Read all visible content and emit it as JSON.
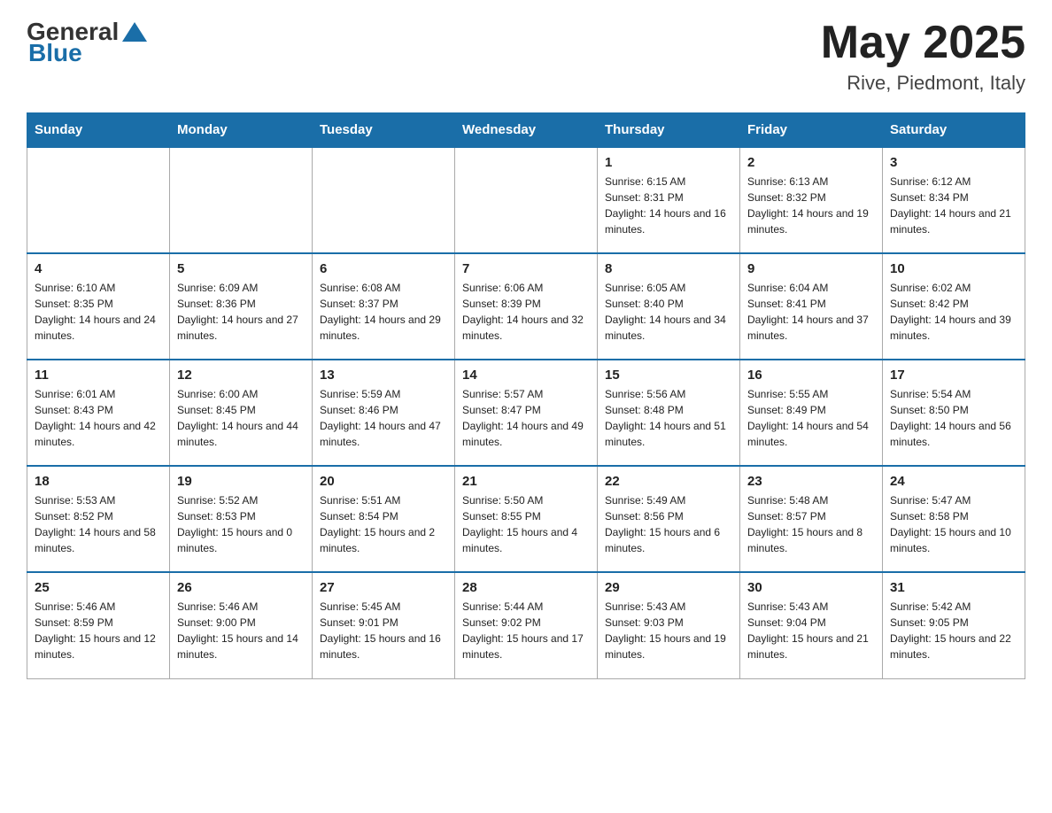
{
  "header": {
    "logo": {
      "general": "General",
      "blue": "Blue"
    },
    "month_year": "May 2025",
    "location": "Rive, Piedmont, Italy"
  },
  "days_of_week": [
    "Sunday",
    "Monday",
    "Tuesday",
    "Wednesday",
    "Thursday",
    "Friday",
    "Saturday"
  ],
  "weeks": [
    {
      "days": [
        {
          "num": "",
          "info": ""
        },
        {
          "num": "",
          "info": ""
        },
        {
          "num": "",
          "info": ""
        },
        {
          "num": "",
          "info": ""
        },
        {
          "num": "1",
          "info": "Sunrise: 6:15 AM\nSunset: 8:31 PM\nDaylight: 14 hours and 16 minutes."
        },
        {
          "num": "2",
          "info": "Sunrise: 6:13 AM\nSunset: 8:32 PM\nDaylight: 14 hours and 19 minutes."
        },
        {
          "num": "3",
          "info": "Sunrise: 6:12 AM\nSunset: 8:34 PM\nDaylight: 14 hours and 21 minutes."
        }
      ]
    },
    {
      "days": [
        {
          "num": "4",
          "info": "Sunrise: 6:10 AM\nSunset: 8:35 PM\nDaylight: 14 hours and 24 minutes."
        },
        {
          "num": "5",
          "info": "Sunrise: 6:09 AM\nSunset: 8:36 PM\nDaylight: 14 hours and 27 minutes."
        },
        {
          "num": "6",
          "info": "Sunrise: 6:08 AM\nSunset: 8:37 PM\nDaylight: 14 hours and 29 minutes."
        },
        {
          "num": "7",
          "info": "Sunrise: 6:06 AM\nSunset: 8:39 PM\nDaylight: 14 hours and 32 minutes."
        },
        {
          "num": "8",
          "info": "Sunrise: 6:05 AM\nSunset: 8:40 PM\nDaylight: 14 hours and 34 minutes."
        },
        {
          "num": "9",
          "info": "Sunrise: 6:04 AM\nSunset: 8:41 PM\nDaylight: 14 hours and 37 minutes."
        },
        {
          "num": "10",
          "info": "Sunrise: 6:02 AM\nSunset: 8:42 PM\nDaylight: 14 hours and 39 minutes."
        }
      ]
    },
    {
      "days": [
        {
          "num": "11",
          "info": "Sunrise: 6:01 AM\nSunset: 8:43 PM\nDaylight: 14 hours and 42 minutes."
        },
        {
          "num": "12",
          "info": "Sunrise: 6:00 AM\nSunset: 8:45 PM\nDaylight: 14 hours and 44 minutes."
        },
        {
          "num": "13",
          "info": "Sunrise: 5:59 AM\nSunset: 8:46 PM\nDaylight: 14 hours and 47 minutes."
        },
        {
          "num": "14",
          "info": "Sunrise: 5:57 AM\nSunset: 8:47 PM\nDaylight: 14 hours and 49 minutes."
        },
        {
          "num": "15",
          "info": "Sunrise: 5:56 AM\nSunset: 8:48 PM\nDaylight: 14 hours and 51 minutes."
        },
        {
          "num": "16",
          "info": "Sunrise: 5:55 AM\nSunset: 8:49 PM\nDaylight: 14 hours and 54 minutes."
        },
        {
          "num": "17",
          "info": "Sunrise: 5:54 AM\nSunset: 8:50 PM\nDaylight: 14 hours and 56 minutes."
        }
      ]
    },
    {
      "days": [
        {
          "num": "18",
          "info": "Sunrise: 5:53 AM\nSunset: 8:52 PM\nDaylight: 14 hours and 58 minutes."
        },
        {
          "num": "19",
          "info": "Sunrise: 5:52 AM\nSunset: 8:53 PM\nDaylight: 15 hours and 0 minutes."
        },
        {
          "num": "20",
          "info": "Sunrise: 5:51 AM\nSunset: 8:54 PM\nDaylight: 15 hours and 2 minutes."
        },
        {
          "num": "21",
          "info": "Sunrise: 5:50 AM\nSunset: 8:55 PM\nDaylight: 15 hours and 4 minutes."
        },
        {
          "num": "22",
          "info": "Sunrise: 5:49 AM\nSunset: 8:56 PM\nDaylight: 15 hours and 6 minutes."
        },
        {
          "num": "23",
          "info": "Sunrise: 5:48 AM\nSunset: 8:57 PM\nDaylight: 15 hours and 8 minutes."
        },
        {
          "num": "24",
          "info": "Sunrise: 5:47 AM\nSunset: 8:58 PM\nDaylight: 15 hours and 10 minutes."
        }
      ]
    },
    {
      "days": [
        {
          "num": "25",
          "info": "Sunrise: 5:46 AM\nSunset: 8:59 PM\nDaylight: 15 hours and 12 minutes."
        },
        {
          "num": "26",
          "info": "Sunrise: 5:46 AM\nSunset: 9:00 PM\nDaylight: 15 hours and 14 minutes."
        },
        {
          "num": "27",
          "info": "Sunrise: 5:45 AM\nSunset: 9:01 PM\nDaylight: 15 hours and 16 minutes."
        },
        {
          "num": "28",
          "info": "Sunrise: 5:44 AM\nSunset: 9:02 PM\nDaylight: 15 hours and 17 minutes."
        },
        {
          "num": "29",
          "info": "Sunrise: 5:43 AM\nSunset: 9:03 PM\nDaylight: 15 hours and 19 minutes."
        },
        {
          "num": "30",
          "info": "Sunrise: 5:43 AM\nSunset: 9:04 PM\nDaylight: 15 hours and 21 minutes."
        },
        {
          "num": "31",
          "info": "Sunrise: 5:42 AM\nSunset: 9:05 PM\nDaylight: 15 hours and 22 minutes."
        }
      ]
    }
  ]
}
